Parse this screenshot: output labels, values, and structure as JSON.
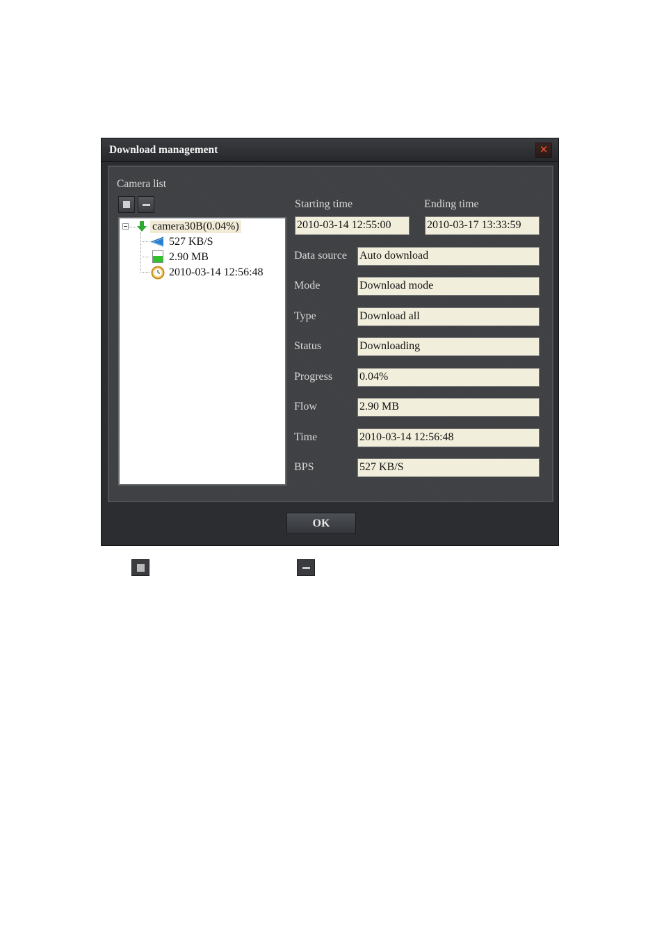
{
  "window": {
    "title": "Download management",
    "close_glyph": "✕"
  },
  "camera_list": {
    "label": "Camera list",
    "toolbar": {
      "expand_icon": "square-icon",
      "collapse_icon": "minus-icon"
    },
    "tree": {
      "root": {
        "label": "camera30B(0.04%)",
        "icon": "download-arrow-icon"
      },
      "children": [
        {
          "label": "527 KB/S",
          "icon": "speed-icon"
        },
        {
          "label": "2.90 MB",
          "icon": "storage-icon"
        },
        {
          "label": "2010-03-14 12:56:48",
          "icon": "clock-icon"
        }
      ]
    }
  },
  "details": {
    "starting_time_label": "Starting time",
    "starting_time_value": "2010-03-14 12:55:00",
    "ending_time_label": "Ending time",
    "ending_time_value": "2010-03-17 13:33:59",
    "rows": [
      {
        "label": "Data source",
        "value": "Auto download"
      },
      {
        "label": "Mode",
        "value": "Download mode"
      },
      {
        "label": "Type",
        "value": "Download all"
      },
      {
        "label": "Status",
        "value": "Downloading"
      },
      {
        "label": "Progress",
        "value": "0.04%"
      },
      {
        "label": "Flow",
        "value": "2.90 MB"
      },
      {
        "label": "Time",
        "value": "2010-03-14 12:56:48"
      },
      {
        "label": "BPS",
        "value": "527 KB/S"
      }
    ]
  },
  "footer": {
    "ok_label": "OK"
  },
  "colors": {
    "dialog_bg": "#2b2d30",
    "panel_bg": "#3d3f42",
    "field_bg": "#f2eedc",
    "close_x": "#e8502c",
    "tree_selected_bg": "#f0ead6"
  }
}
